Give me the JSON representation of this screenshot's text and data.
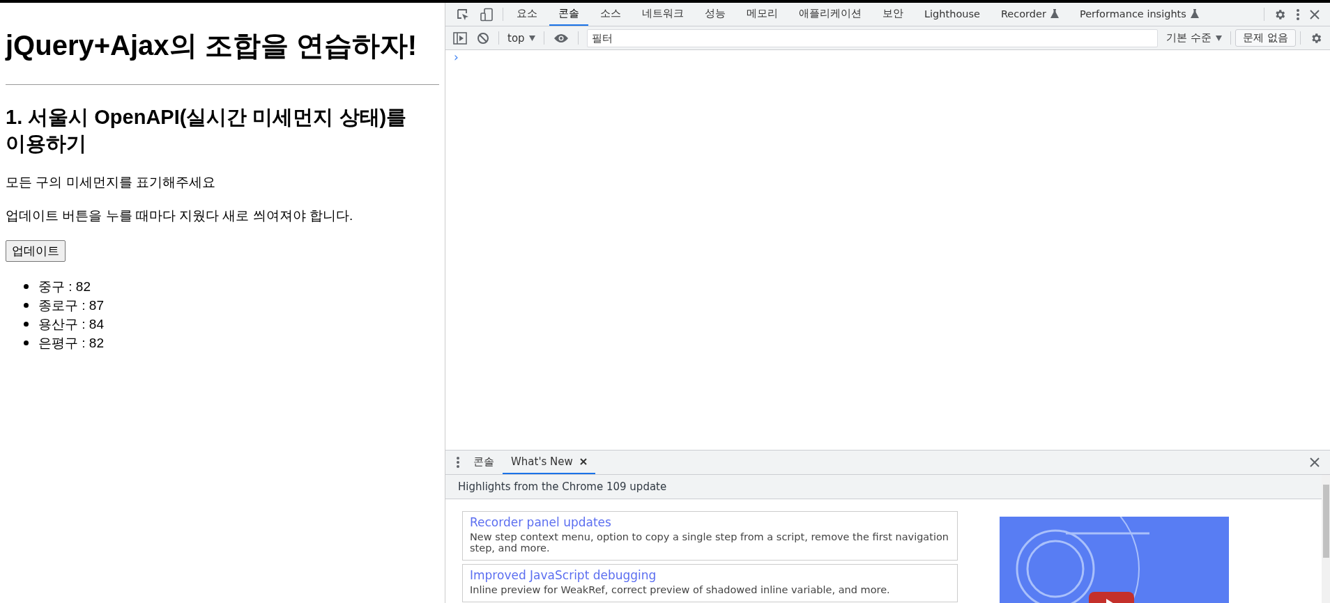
{
  "page": {
    "title": "jQuery+Ajax의 조합을 연습하자!",
    "section_title": "1. 서울시 OpenAPI(실시간 미세먼지 상태)를 이용하기",
    "paragraphs": [
      "모든 구의 미세먼지를 표기해주세요",
      "업데이트 버튼을 누를 때마다 지웠다 새로 씌여져야 합니다."
    ],
    "button": "업데이트",
    "items": [
      "중구 : 82",
      "종로구 : 87",
      "용산구 : 84",
      "은평구 : 82"
    ]
  },
  "devtools": {
    "tabs": [
      {
        "label": "요소",
        "selected": false,
        "experimental": false
      },
      {
        "label": "콘솔",
        "selected": true,
        "experimental": false
      },
      {
        "label": "소스",
        "selected": false,
        "experimental": false
      },
      {
        "label": "네트워크",
        "selected": false,
        "experimental": false
      },
      {
        "label": "성능",
        "selected": false,
        "experimental": false
      },
      {
        "label": "메모리",
        "selected": false,
        "experimental": false
      },
      {
        "label": "애플리케이션",
        "selected": false,
        "experimental": false
      },
      {
        "label": "보안",
        "selected": false,
        "experimental": false
      },
      {
        "label": "Lighthouse",
        "selected": false,
        "experimental": false
      },
      {
        "label": "Recorder",
        "selected": false,
        "experimental": true
      },
      {
        "label": "Performance insights",
        "selected": false,
        "experimental": true
      }
    ],
    "toolbar": {
      "context": "top",
      "filter_placeholder": "필터",
      "levels": "기본 수준",
      "issues": "문제 없음"
    },
    "prompt": "›",
    "drawer": {
      "tabs": [
        {
          "label": "콘솔",
          "selected": false,
          "closable": false
        },
        {
          "label": "What's New",
          "selected": true,
          "closable": true
        }
      ],
      "heading": "Highlights from the Chrome 109 update",
      "cards": [
        {
          "title": "Recorder panel updates",
          "text": "New step context menu, option to copy a single step from a script, remove the first navigation step, and more."
        },
        {
          "title": "Improved JavaScript debugging",
          "text": "Inline preview for WeakRef, correct preview of shadowed inline variable, and more."
        }
      ]
    }
  }
}
